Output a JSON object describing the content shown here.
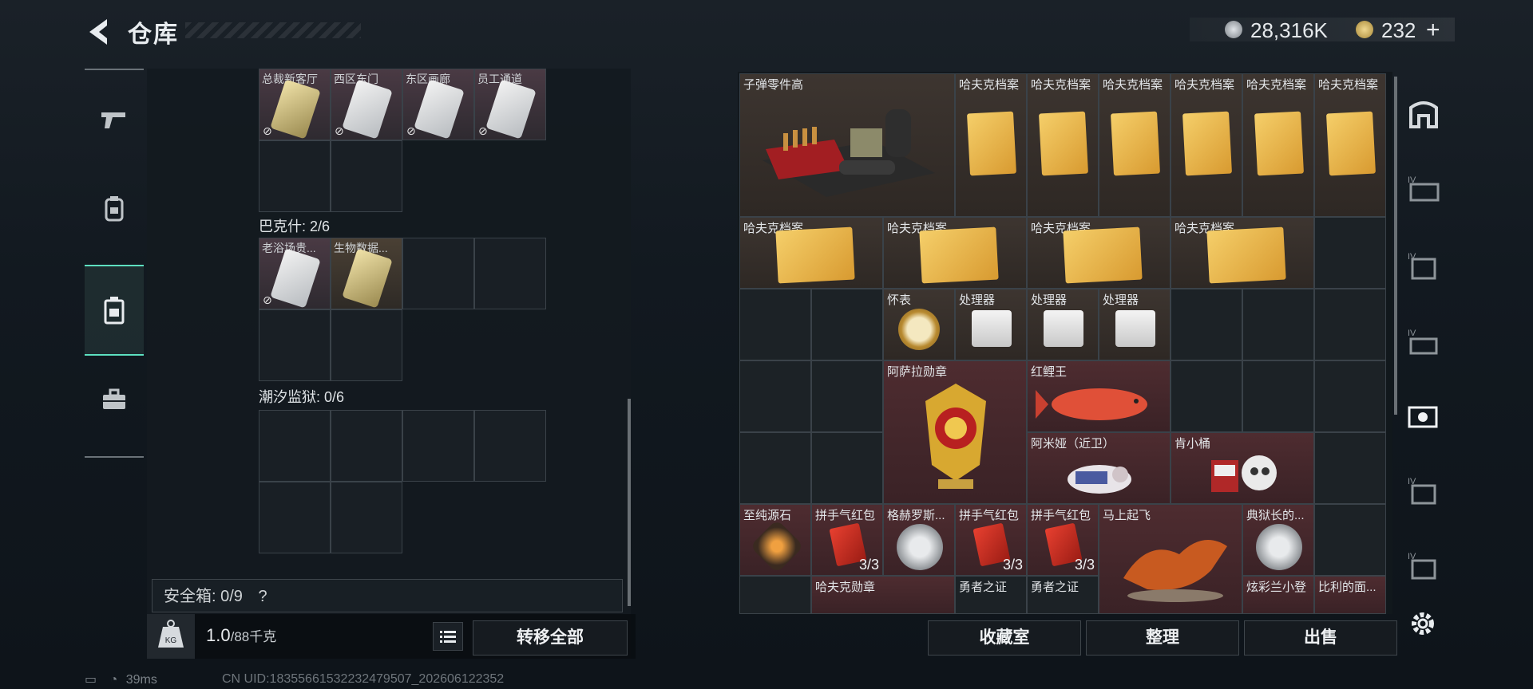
{
  "header": {
    "title": "仓库",
    "currency_silver": "28,316K",
    "currency_gold": "232",
    "plus": "+"
  },
  "left": {
    "top_row_items": [
      {
        "label": "总裁新客厅"
      },
      {
        "label": "西区东门"
      },
      {
        "label": "东区画廊"
      },
      {
        "label": "员工通道"
      }
    ],
    "section_bakeshi": "巴克什: 2/6",
    "bakeshi_items": [
      {
        "label": "老浴场贵..."
      },
      {
        "label": "生物数据..."
      }
    ],
    "section_chaoxi": "潮汐监狱: 0/6",
    "safebox": "安全箱: 0/9",
    "safebox_help": "?",
    "weight_value": "1.0",
    "weight_max": "/88千克",
    "transfer_all": "转移全部",
    "kg_icon_text": "KG"
  },
  "right": {
    "cells": {
      "ammo": "子弹零件高",
      "haf": "哈夫克档案",
      "watch": "怀表",
      "cpu": "处理器",
      "medal_asala": "阿萨拉勋章",
      "carp": "红鲤王",
      "amiya": "阿米娅（近卫）",
      "kenxiaotong": "肯小桶",
      "zhichunyuanshi": "至纯源石",
      "hongbao": "拼手气红包",
      "gehe": "格赫罗斯...",
      "mashang": "马上起飞",
      "dianyu": "典狱长的...",
      "hafmedal": "哈夫克勋章",
      "yongzhe": "勇者之证",
      "xuancai": "炫彩兰小登",
      "bili": "比利的面...",
      "qty33": "3/3"
    },
    "buttons": {
      "collection": "收藏室",
      "sort": "整理",
      "sell": "出售"
    }
  },
  "status": {
    "ping": "39ms",
    "uid": "CN UID:18355661532232479507_202606122352"
  },
  "colors": {
    "accent": "#5de0c0",
    "item_red": "#4e2c30",
    "item_tan": "#3d3530"
  }
}
